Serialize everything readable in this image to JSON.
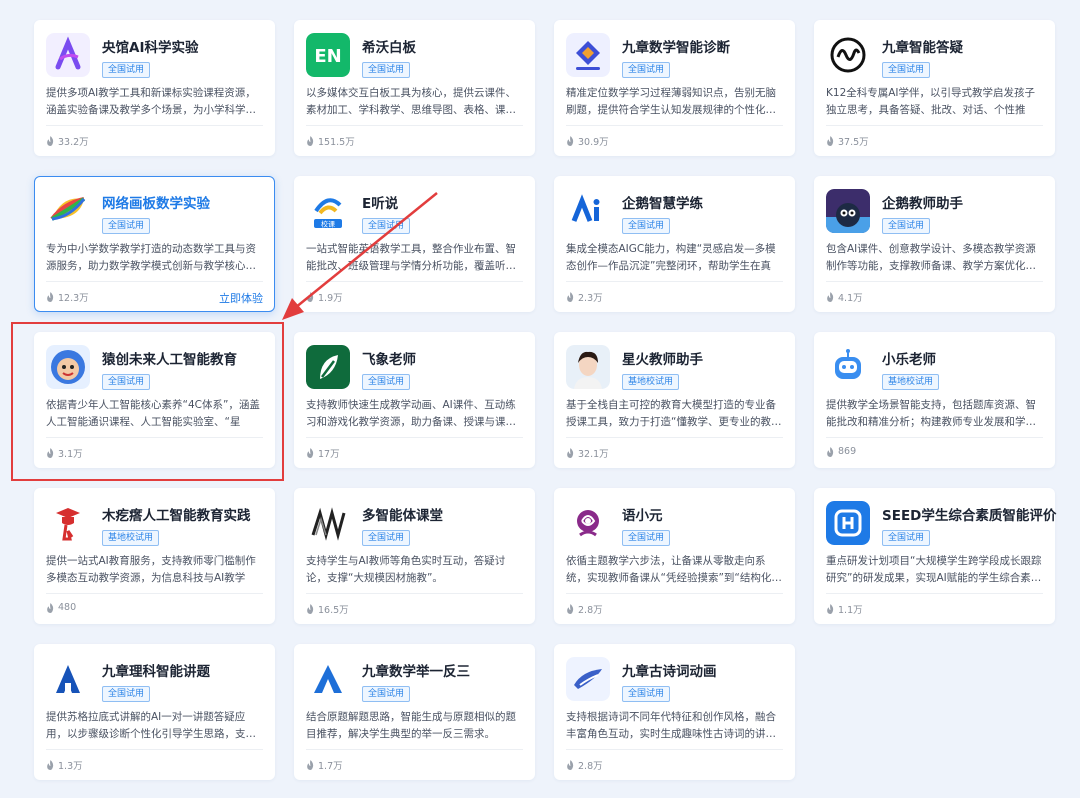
{
  "colors": {
    "accent": "#1e7ae6",
    "highlight": "#e23d3d",
    "badge_border": "#8fbef3"
  },
  "cards": [
    {
      "title": "央馆AI科学实验",
      "badge": "全国试用",
      "desc": "提供多项AI教学工具和新课标实验课程资源，涵盖实验备课及教学多个场景，为小学科学…",
      "hot": "33.2万",
      "logo": "ai-science-logo"
    },
    {
      "title": "希沃白板",
      "badge": "全国试用",
      "desc": "以多媒体交互白板工具为核心，提供云课件、素材加工、学科教学、思维导图、表格、课…",
      "hot": "151.5万",
      "logo": "en-logo",
      "logo_text": "EN"
    },
    {
      "title": "九章数学智能诊断",
      "badge": "全国试用",
      "desc": "精准定位数学学习过程薄弱知识点，告别无脑刷题，提供符合学生认知发展规律的个性化…",
      "hot": "30.9万",
      "logo": "diamond-logo"
    },
    {
      "title": "九章智能答疑",
      "badge": "全国试用",
      "desc": "K12全科专属AI学伴，以引导式教学启发孩子独立思考，具备答疑、批改、对话、个性推题…",
      "hot": "37.5万",
      "logo": "wave-circle-logo"
    },
    {
      "title": "网络画板数学实验",
      "badge": "全国试用",
      "desc": "专为中小学数学教学打造的动态数学工具与资源服务，助力数学教学模式创新与教学核心…",
      "hot": "12.3万",
      "try": "立即体验",
      "logo": "rainbow-leaf-logo",
      "active": true
    },
    {
      "title": "E听说",
      "badge": "全国试用",
      "desc": "一站式智能英语教学工具，整合作业布置、智能批改、班级管理与学情分析功能，覆盖听…",
      "hot": "1.9万",
      "logo": "e-listen-logo",
      "logo_text": "校课"
    },
    {
      "title": "企鹅智慧学练",
      "badge": "全国试用",
      "desc": "集成全模态AIGC能力，构建“灵感启发—多模态创作—作品沉淀”完整闭环，帮助学生在真实…",
      "hot": "2.3万",
      "logo": "ai-letters-logo"
    },
    {
      "title": "企鹅教师助手",
      "badge": "全国试用",
      "desc": "包含AI课件、创意教学设计、多模态教学资源制作等功能，支撑教师备课、教学方案优化…",
      "hot": "4.1万",
      "logo": "penguin-logo"
    },
    {
      "title": "猿创未来人工智能教育",
      "badge": "全国试用",
      "desc": "依据青少年人工智能核心素养“4C体系”，涵盖人工智能通识课程、人工智能实验室、“星海”…",
      "hot": "3.1万",
      "logo": "monkey-logo"
    },
    {
      "title": "飞象老师",
      "badge": "全国试用",
      "desc": "支持教师快速生成教学动画、AI课件、互动练习和游戏化教学资源，助力备课、授课与课…",
      "hot": "17万",
      "logo": "leaf-green-logo"
    },
    {
      "title": "星火教师助手",
      "badge": "基地校试用",
      "desc": "基于全栈自主可控的教育大模型打造的专业备授课工具，致力于打造“懂教学、更专业的教…",
      "hot": "32.1万",
      "logo": "avatar-logo"
    },
    {
      "title": "小乐老师",
      "badge": "基地校试用",
      "desc": "提供教学全场景智能支持，包括题库资源、智能批改和精准分析；构建教师专业发展和学…",
      "hot": "869",
      "logo": "robot-logo"
    },
    {
      "title": "木疙瘩人工智能教育实践",
      "badge": "基地校试用",
      "desc": "提供一站式AI教育服务，支持教师零门槛制作多模态互动教学资源，为信息科技与AI教学提…",
      "hot": "480",
      "logo": "graduate-logo"
    },
    {
      "title": "多智能体课堂",
      "badge": "全国试用",
      "desc": "支持学生与AI教师等角色实时互动，答疑讨论，支撑“大规模因材施教”。",
      "hot": "16.5万",
      "logo": "mm-logo"
    },
    {
      "title": "语小元",
      "badge": "全国试用",
      "desc": "依循主题教学六步法，让备课从零散走向系统，实现教师备课从“凭经验摸索”到“结构化…",
      "hot": "2.8万",
      "logo": "rose-logo"
    },
    {
      "title": "SEED学生综合素质智能评价",
      "badge": "全国试用",
      "desc": "重点研发计划项目“大规模学生跨学段成长跟踪研究”的研发成果，实现AI赋能的学生综合素…",
      "hot": "1.1万",
      "logo": "seed-logo"
    },
    {
      "title": "九章理科智能讲题",
      "badge": "全国试用",
      "desc": "提供苏格拉底式讲解的AI一对一讲题答疑应用，以步骤级诊断个性化引导学生思路，支…",
      "hot": "1.3万",
      "logo": "arrow-up-logo"
    },
    {
      "title": "九章数学举一反三",
      "badge": "全国试用",
      "desc": "结合原题解题思路，智能生成与原题相似的题目推荐，解决学生典型的举一反三需求。",
      "hot": "1.7万",
      "logo": "triangle-logo"
    },
    {
      "title": "九章古诗词动画",
      "badge": "全国试用",
      "desc": "支持根据诗词不同年代特征和创作风格，融合丰富角色互动，实时生成趣味性古诗词的讲…",
      "hot": "2.8万",
      "logo": "scroll-logo"
    }
  ]
}
